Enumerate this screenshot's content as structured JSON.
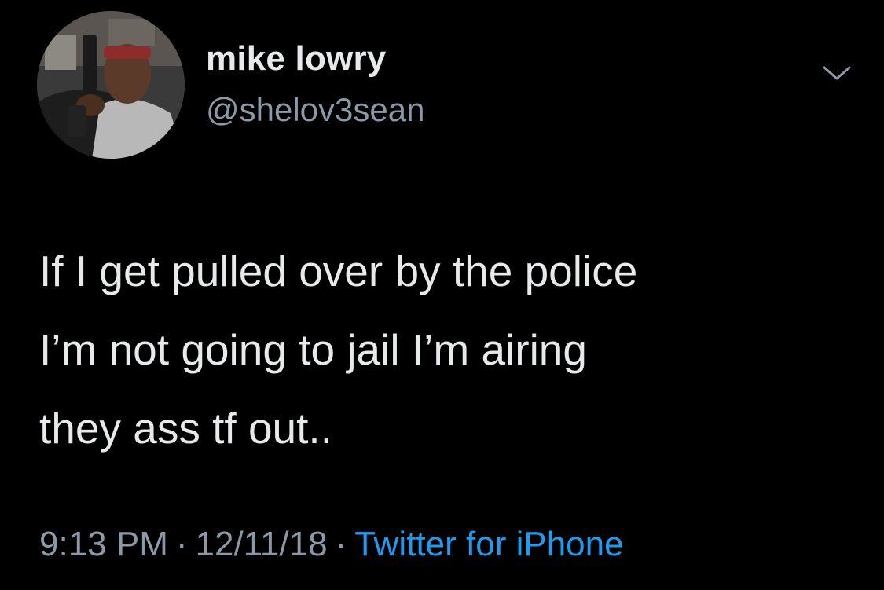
{
  "user": {
    "display_name": "mike lowry",
    "handle": "@shelov3sean"
  },
  "tweet": {
    "lines": [
      "If I get pulled over by the police",
      "I’m not going to jail I’m airing",
      "they ass tf out.."
    ]
  },
  "meta": {
    "time": "9:13 PM",
    "separator": "·",
    "date": "12/11/18",
    "source": "Twitter for iPhone"
  },
  "icons": {
    "more": "chevron-down-icon",
    "avatar": "profile-photo"
  },
  "colors": {
    "background": "#000000",
    "primary_text": "#e7e9ea",
    "secondary_text": "#8b98a5",
    "link": "#1d9bf0"
  }
}
